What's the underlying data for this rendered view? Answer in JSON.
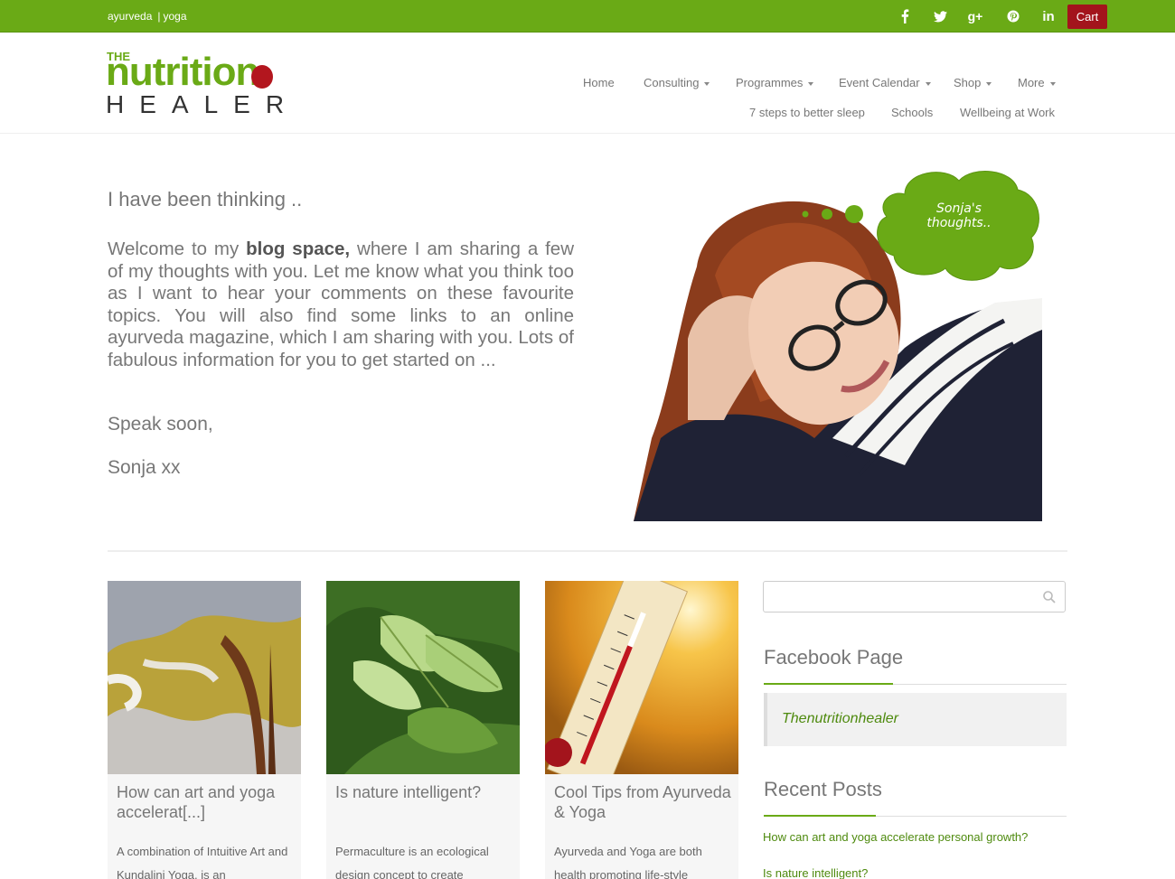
{
  "topbar": {
    "left_links": [
      "ayurveda",
      "yoga"
    ],
    "separator": "|",
    "social": [
      "f",
      "t",
      "g+",
      "p",
      "in"
    ],
    "cart_label": "Cart"
  },
  "logo": {
    "the": "THE",
    "nutrition": "nutrition",
    "healer": "HEALER"
  },
  "nav": {
    "row1": [
      {
        "label": "Home",
        "dropdown": false
      },
      {
        "label": "Consulting",
        "dropdown": true
      },
      {
        "label": "Programmes",
        "dropdown": true
      },
      {
        "label": "Event Calendar",
        "dropdown": true
      },
      {
        "label": "Shop",
        "dropdown": true
      },
      {
        "label": "More",
        "dropdown": true
      }
    ],
    "row2": [
      {
        "label": "7 steps to better sleep"
      },
      {
        "label": "Schools"
      },
      {
        "label": "Wellbeing at Work"
      }
    ]
  },
  "intro": {
    "heading": "I have been thinking ..",
    "body_pre": "Welcome to my ",
    "body_bold": "blog space,",
    "body_post": " where I am sharing a few of my thoughts with you. Let me know what you think too as I want to hear your comments on these favourite topics. You will also find some links to an online ayurveda magazine, which I am sharing with you. Lots of fabulous information for you to get started on ...",
    "closing": "Speak soon,",
    "signature": "Sonja xx",
    "bubble": "Sonja's thoughts.."
  },
  "cards": [
    {
      "title": "How can art and yoga accelerat[...]",
      "excerpt": "A combination of Intuitive Art and Kundalini Yoga, is an",
      "image": "abstract-painting"
    },
    {
      "title": "Is nature intelligent?",
      "excerpt": "Permaculture is an ecological design concept to create",
      "image": "green-leaves"
    },
    {
      "title": "Cool Tips from Ayurveda & Yoga",
      "excerpt": "Ayurveda and Yoga are both health promoting life-style",
      "image": "thermometer-sun"
    }
  ],
  "sidebar": {
    "search_placeholder": "",
    "facebook_heading": "Facebook Page",
    "facebook_link": "Thenutritionhealer",
    "recent_heading": "Recent Posts",
    "recent_posts": [
      "How can art and yoga accelerate personal growth?",
      "Is nature intelligent?"
    ]
  },
  "colors": {
    "brand_green": "#6aaa16",
    "cart_red": "#a3141c",
    "link_green": "#4e8a0e"
  }
}
